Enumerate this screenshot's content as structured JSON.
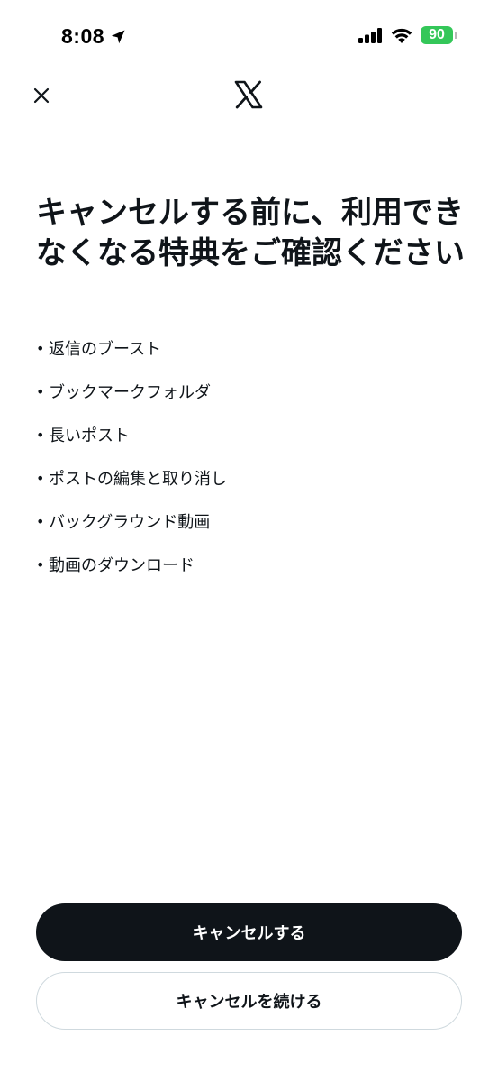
{
  "status_bar": {
    "time": "8:08",
    "battery_level": "90",
    "battery_color": "#34c759",
    "icons": [
      "location-arrow-icon",
      "signal-bars-icon",
      "wifi-icon",
      "battery-charging-icon"
    ]
  },
  "nav": {
    "close_icon": "close-icon",
    "logo_icon": "x-logo-icon"
  },
  "headline": "キャンセルする前に、利用できなくなる特典をご確認ください",
  "perks": [
    {
      "bullet": "•",
      "label": "返信のブースト"
    },
    {
      "bullet": "•",
      "label": "ブックマークフォルダ"
    },
    {
      "bullet": "•",
      "label": "長いポスト"
    },
    {
      "bullet": "•",
      "label": "ポストの編集と取り消し"
    },
    {
      "bullet": "•",
      "label": "バックグラウンド動画"
    },
    {
      "bullet": "•",
      "label": "動画のダウンロード"
    }
  ],
  "actions": {
    "cancel_label": "キャンセルする",
    "continue_label": "キャンセルを続ける"
  },
  "colors": {
    "text": "#0f1419",
    "primary_button_bg": "#0f1419",
    "secondary_button_border": "#cfd9de",
    "background": "#ffffff"
  }
}
